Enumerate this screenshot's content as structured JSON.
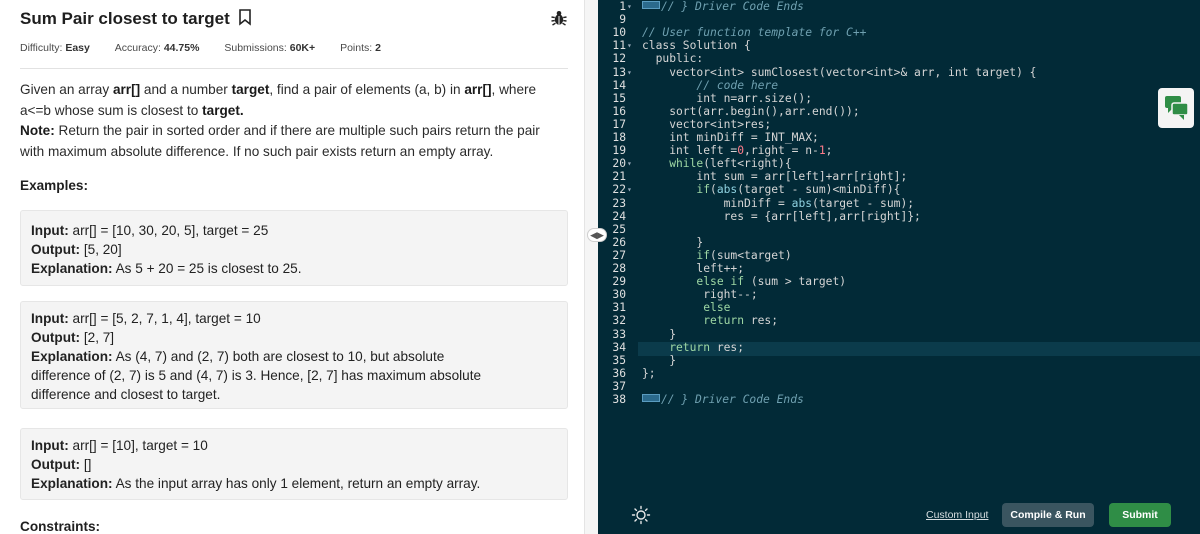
{
  "problem": {
    "title": "Sum Pair closest to target",
    "difficulty_label": "Difficulty:",
    "difficulty": "Easy",
    "accuracy_label": "Accuracy:",
    "accuracy": "44.75%",
    "submissions_label": "Submissions:",
    "submissions": "60K+",
    "points_label": "Points:",
    "points": "2",
    "desc_1a": "Given an array ",
    "desc_1b": "arr[]",
    "desc_1c": " and a number ",
    "desc_1d": "target",
    "desc_1e": ", find a pair of elements (a, b) in ",
    "desc_1f": "arr[]",
    "desc_1g": ", where",
    "desc_2a": "a<=b whose sum is closest to ",
    "desc_2b": "target.",
    "desc_3a": "Note: ",
    "desc_3b": "Return the pair in sorted order and if there are multiple such pairs return the pair",
    "desc_4": "with maximum absolute difference. If no such pair exists return an empty array.",
    "examples_heading": "Examples:",
    "constraints_heading": "Constraints:",
    "input_label": "Input:",
    "output_label": "Output:",
    "explanation_label": "Explanation:",
    "examples": [
      {
        "input": "arr[] = [10, 30, 20, 5], target = 25",
        "output": "[5, 20]",
        "explanation": "As 5 + 20 = 25 is closest to 25."
      },
      {
        "input": "arr[] = [5, 2, 7, 1, 4], target = 10",
        "output": "[2, 7]",
        "explanation_1": "As (4, 7) and (2, 7) both are closest to 10, but absolute",
        "explanation_2": "difference of (2, 7) is 5 and (4, 7) is 3. Hence, [2, 7] has maximum absolute",
        "explanation_3": "difference and closest to target."
      },
      {
        "input": "arr[] = [10], target = 10",
        "output": "[]",
        "explanation": "As the input array has only 1 element, return an empty array."
      }
    ]
  },
  "editor": {
    "lines": [
      {
        "n": "1",
        "parts": [
          [
            "fold",
            ""
          ],
          [
            "com",
            "// } Driver Code Ends"
          ]
        ]
      },
      {
        "n": "9",
        "parts": []
      },
      {
        "n": "10",
        "parts": [
          [
            "com",
            "// User function template for C++"
          ]
        ]
      },
      {
        "n": "11",
        "parts": [
          [
            "kw",
            "class Solution {"
          ]
        ]
      },
      {
        "n": "12",
        "parts": [
          [
            "kw",
            "  public:"
          ]
        ]
      },
      {
        "n": "13",
        "parts": [
          [
            "kw",
            "    vector<int> sumClosest(vector<int>& arr, int target) {"
          ]
        ]
      },
      {
        "n": "14",
        "parts": [
          [
            "com",
            "        // code here"
          ]
        ]
      },
      {
        "n": "15",
        "parts": [
          [
            "kw",
            "        int n=arr.size();"
          ]
        ]
      },
      {
        "n": "16",
        "parts": [
          [
            "kw",
            "    sort(arr.begin(),arr.end());"
          ]
        ]
      },
      {
        "n": "17",
        "parts": [
          [
            "kw",
            "    vector<int>res;"
          ]
        ]
      },
      {
        "n": "18",
        "parts": [
          [
            "kw",
            "    int minDiff = INT_MAX;"
          ]
        ]
      },
      {
        "n": "19",
        "parts": [
          [
            "kw",
            "    int left ="
          ],
          [
            "num",
            "0"
          ],
          [
            "kw",
            ",right = n-"
          ],
          [
            "num",
            "1"
          ],
          [
            "kw",
            ";"
          ]
        ]
      },
      {
        "n": "20",
        "parts": [
          [
            "op",
            "    while"
          ],
          [
            "kw",
            "(left<right){"
          ]
        ]
      },
      {
        "n": "21",
        "parts": [
          [
            "kw",
            "        int sum = arr[left]+arr[right];"
          ]
        ]
      },
      {
        "n": "22",
        "parts": [
          [
            "op",
            "        if"
          ],
          [
            "kw",
            "("
          ],
          [
            "fn",
            "abs"
          ],
          [
            "kw",
            "(target - sum)<minDiff){"
          ]
        ]
      },
      {
        "n": "23",
        "parts": [
          [
            "kw",
            "            minDiff = "
          ],
          [
            "fn",
            "abs"
          ],
          [
            "kw",
            "(target - sum);"
          ]
        ]
      },
      {
        "n": "24",
        "parts": [
          [
            "kw",
            "            res = {arr[left],arr[right]};"
          ]
        ]
      },
      {
        "n": "25",
        "parts": []
      },
      {
        "n": "26",
        "parts": [
          [
            "kw",
            "        }"
          ]
        ]
      },
      {
        "n": "27",
        "parts": [
          [
            "op",
            "        if"
          ],
          [
            "kw",
            "(sum<target)"
          ]
        ]
      },
      {
        "n": "28",
        "parts": [
          [
            "kw",
            "        left++;"
          ]
        ]
      },
      {
        "n": "29",
        "parts": [
          [
            "op",
            "        else if"
          ],
          [
            "kw",
            " (sum > target)"
          ]
        ]
      },
      {
        "n": "30",
        "parts": [
          [
            "kw",
            "         right--;"
          ]
        ]
      },
      {
        "n": "31",
        "parts": [
          [
            "op",
            "         else"
          ]
        ]
      },
      {
        "n": "32",
        "parts": [
          [
            "op",
            "         return"
          ],
          [
            "kw",
            " res;"
          ]
        ]
      },
      {
        "n": "33",
        "parts": [
          [
            "kw",
            "    }"
          ]
        ]
      },
      {
        "n": "34",
        "parts": [
          [
            "op",
            "    return"
          ],
          [
            "kw",
            " res;"
          ]
        ]
      },
      {
        "n": "35",
        "parts": [
          [
            "kw",
            "    }"
          ]
        ]
      },
      {
        "n": "36",
        "parts": [
          [
            "kw",
            "};"
          ]
        ]
      },
      {
        "n": "37",
        "parts": []
      },
      {
        "n": "38",
        "parts": [
          [
            "fold",
            ""
          ],
          [
            "com",
            "// } Driver Code Ends"
          ]
        ]
      }
    ],
    "fold_lines": [
      "1",
      "11",
      "13",
      "20",
      "22"
    ]
  },
  "footer": {
    "custom_input": "Custom Input",
    "compile_run": "Compile & Run",
    "submit": "Submit"
  },
  "colors": {
    "editor_bg": "#022a37",
    "submit_green": "#2f8d46",
    "compile_bg": "#3a5560"
  },
  "icons": {
    "bookmark": "bookmark-icon",
    "bug": "bug-icon",
    "theme": "sun-icon",
    "chat": "chat-icon",
    "drag": "drag-handle-icon"
  }
}
